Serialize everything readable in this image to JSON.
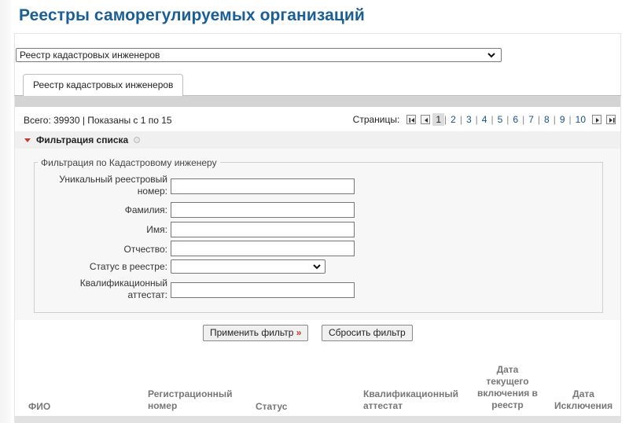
{
  "page": {
    "title": "Реестры саморегулируемых организаций"
  },
  "registry_select": {
    "value": "Реестр кадастровых инженеров"
  },
  "tabs": [
    {
      "label": "Реестр кадастровых инженеров"
    }
  ],
  "stats": {
    "text": "Всего: 39930 |  Показаны с 1  по 15"
  },
  "pager": {
    "label": "Страницы:",
    "current": "1",
    "pages": [
      "1",
      "2",
      "3",
      "4",
      "5",
      "6",
      "7",
      "8",
      "9",
      "10"
    ],
    "separator": "|"
  },
  "filter": {
    "header": "Фильтрация списка",
    "legend": "Фильтрация по Кадастровому инженеру",
    "fields": {
      "registry_number": {
        "label_line1": "Уникальный реестровый",
        "label_line2": "номер:",
        "value": ""
      },
      "last_name": {
        "label": "Фамилия:",
        "value": ""
      },
      "first_name": {
        "label": "Имя:",
        "value": ""
      },
      "patronymic": {
        "label": "Отчество:",
        "value": ""
      },
      "status": {
        "label": "Статус в реестре:",
        "value": ""
      },
      "certificate": {
        "label_line1": "Квалификационный",
        "label_line2": "аттестат:",
        "value": ""
      }
    },
    "apply_label": "Применить фильтр",
    "apply_arrow": "»",
    "reset_label": "Сбросить фильтр"
  },
  "table": {
    "headers": {
      "fio": [
        "ФИО"
      ],
      "reg_number": [
        "Регистрационный",
        "номер"
      ],
      "status": [
        "Статус"
      ],
      "certificate": [
        "Квалификационный",
        "аттестат"
      ],
      "inclusion_date": [
        "Дата",
        "текущего",
        "включения в",
        "реестр"
      ],
      "exclusion_date": [
        "Дата",
        "Исключения"
      ]
    }
  },
  "colors": {
    "title": "#1a5e96",
    "accent": "#c43a2b",
    "link": "#1a4f8a"
  }
}
